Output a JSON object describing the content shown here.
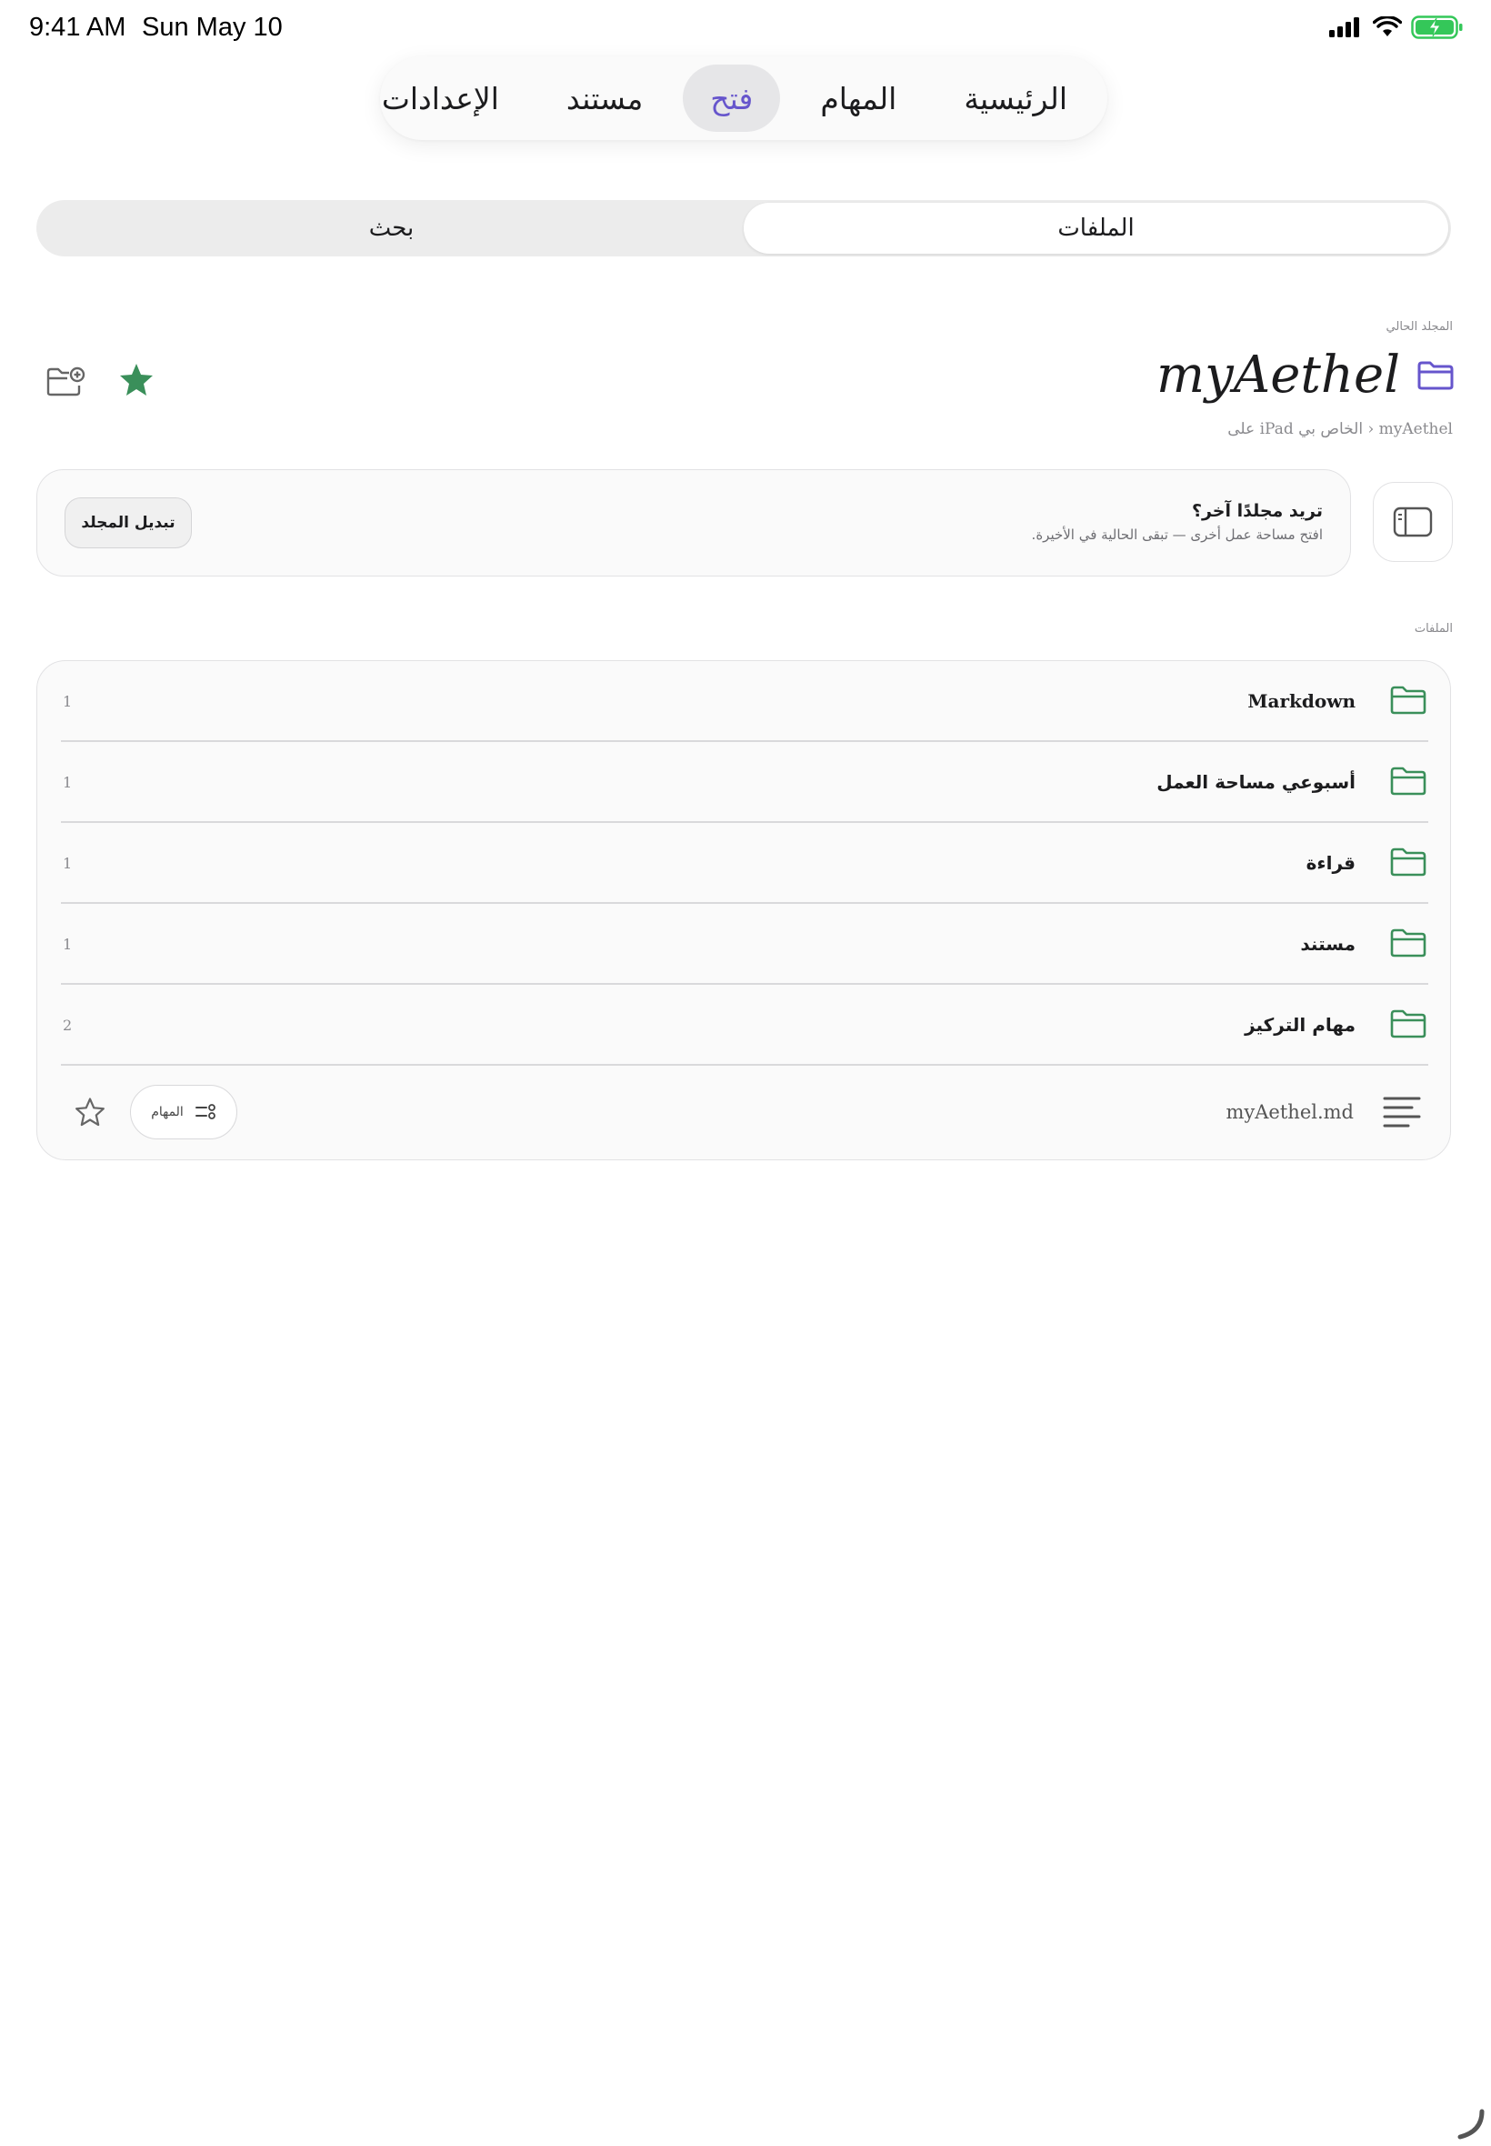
{
  "status_bar": {
    "time": "9:41 AM",
    "date": "Sun May 10"
  },
  "tabs": [
    {
      "label": "الرئيسية",
      "active": false
    },
    {
      "label": "المهام",
      "active": false
    },
    {
      "label": "فتح",
      "active": true
    },
    {
      "label": "مستند",
      "active": false
    },
    {
      "label": "الإعدادات",
      "active": false
    }
  ],
  "segment": {
    "files_label": "الملفات",
    "search_label": "بحث",
    "selected": "الملفات"
  },
  "current_folder": {
    "caption": "المجلد الحالي",
    "title": "myAethel",
    "path": "على iPad الخاص بي › myAethel",
    "favorite": true
  },
  "switch_folder": {
    "title": "تريد مجلدًا آخر؟",
    "subtitle": "افتح مساحة عمل أخرى — تبقى الحالية في الأخيرة.",
    "button_label": "تبديل المجلد"
  },
  "files": {
    "caption": "الملفات",
    "items": [
      {
        "name": "Markdown",
        "count": "1"
      },
      {
        "name": "أسبوعي مساحة العمل",
        "count": "1"
      },
      {
        "name": "قراءة",
        "count": "1"
      },
      {
        "name": "مستند",
        "count": "1"
      },
      {
        "name": "مهام التركيز",
        "count": "2"
      }
    ],
    "document": {
      "name": "myAethel.md",
      "tasks_label": "المهام"
    }
  },
  "colors": {
    "accent": "#6655cc",
    "folder_green": "#3a8f5a",
    "star_green": "#3a8f5a"
  }
}
